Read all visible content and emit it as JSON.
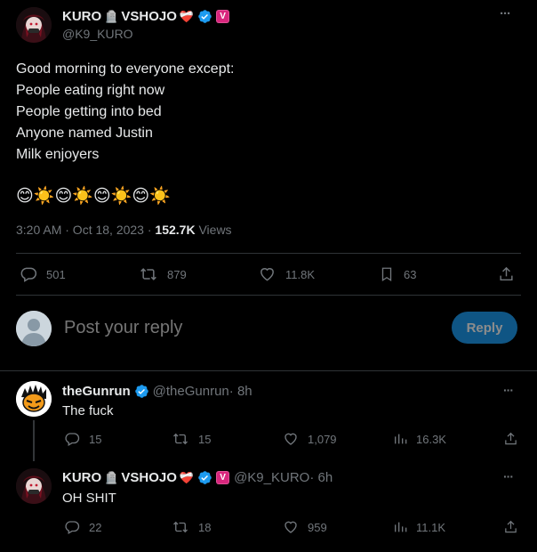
{
  "main_tweet": {
    "display_name": "KURO",
    "name_suffix": "VSHOJO",
    "name_emoji_1": "🪦",
    "name_emoji_2": "❤️‍🩹",
    "v_badge": "V",
    "handle": "@K9_KURO",
    "more": "···",
    "lines": [
      "Good morning to everyone except:",
      "People eating right now",
      "People getting into bed",
      "Anyone named Justin",
      "Milk enjoyers"
    ],
    "emoji_row": "😊☀️😊☀️😊☀️😊☀️",
    "time": "3:20 AM · Oct 18, 2023 · ",
    "views_count": "152.7K",
    "views_label": " Views",
    "stats": {
      "replies": "501",
      "retweets": "879",
      "likes": "11.8K",
      "bookmarks": "63"
    }
  },
  "reply_composer": {
    "placeholder": "Post your reply",
    "button": "Reply"
  },
  "replies": [
    {
      "display_name": "theGunrun",
      "handle": "@theGunrun",
      "time": " · 8h",
      "text": "The fuck",
      "more": "···",
      "stats": {
        "replies": "15",
        "retweets": "15",
        "likes": "1,079",
        "views": "16.3K"
      }
    },
    {
      "display_name": "KURO",
      "name_suffix": "VSHOJO",
      "handle": "@K9_KURO",
      "time": " · 6h",
      "text": "OH SHIT",
      "more": "···",
      "v_badge": "V",
      "stats": {
        "replies": "22",
        "retweets": "18",
        "likes": "959",
        "views": "11.1K"
      }
    }
  ],
  "colors": {
    "background": "#000000",
    "text": "#e7e9ea",
    "muted": "#71767b",
    "verified": "#1d9bf0",
    "divider": "#2f3336"
  }
}
